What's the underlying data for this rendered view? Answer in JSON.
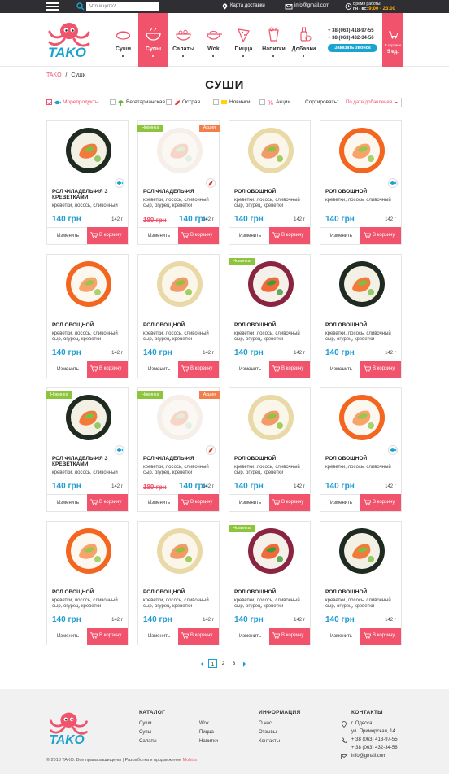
{
  "topbar": {
    "search_placeholder": "Что ищете?",
    "delivery_map": "Карта доставки",
    "email": "info@gmail.com",
    "hours_label": "Время работы:",
    "hours_days": "пн - вс:",
    "hours_time": "9:00 - 23:00"
  },
  "nav": [
    {
      "label": "Суши",
      "icon": "sushi-icon",
      "active": false
    },
    {
      "label": "Супы",
      "icon": "soup-icon",
      "active": true
    },
    {
      "label": "Салаты",
      "icon": "salad-icon",
      "active": false
    },
    {
      "label": "Wok",
      "icon": "wok-icon",
      "active": false
    },
    {
      "label": "Пицца",
      "icon": "pizza-icon",
      "active": false
    },
    {
      "label": "Напитки",
      "icon": "drink-icon",
      "active": false
    },
    {
      "label": "Добавки",
      "icon": "sauce-icon",
      "active": false
    }
  ],
  "contacts": {
    "phone1": "+ 38 (063) 418-97-55",
    "phone2": "+ 38 (063) 432-34-56",
    "call_button": "Заказать звонок"
  },
  "cart": {
    "label": "В корзине",
    "count": "5 ед."
  },
  "breadcrumbs": {
    "home": "TAKO",
    "sep": "/",
    "current": "Суши"
  },
  "page_title": "СУШИ",
  "filters": [
    {
      "label": "Морепродукты",
      "checked": true,
      "color": "#f0536b"
    },
    {
      "label": "Вегетарианская",
      "checked": false,
      "color": "#333333"
    },
    {
      "label": "Острая",
      "checked": false,
      "color": "#333333"
    },
    {
      "label": "Новинки",
      "checked": false,
      "color": "#333333"
    },
    {
      "label": "Акции",
      "checked": false,
      "color": "#333333"
    }
  ],
  "sort": {
    "label": "Сортировать:",
    "value": "По дате добавления"
  },
  "card_buttons": {
    "edit": "Изменить",
    "buy": "В корзину"
  },
  "badges": {
    "new": "Новинка",
    "sale": "Акция"
  },
  "products": [
    {
      "title": "РОЛ ФІЛАДЕЛЬФІЯ З КРЕВЕТКАМИ",
      "desc": "креветки, лосось, сливочный",
      "price": "140 грн",
      "weight": "142 г",
      "img": "green",
      "icon": "fish-icon"
    },
    {
      "title": "РОЛ ФІЛАДЕЛЬФІЯ",
      "desc": "креветки, лосось, сливочный сыр, огурец, креветки",
      "old_price": "189 грн",
      "price": "140 грн",
      "weight": "142 г",
      "img": "pale",
      "new": true,
      "sale": true,
      "icon": "pepper-icon"
    },
    {
      "title": "РОЛ ОВОЩНОЙ",
      "desc": "креветки, лосось, сливочный сыр, огурец, креветки",
      "price": "140 грн",
      "weight": "142 г",
      "img": "sesame"
    },
    {
      "title": "РОЛ ОВОЩНОЙ",
      "desc": "креветки, лосось, сливочный",
      "price": "140 грн",
      "weight": "142 г",
      "img": "orange",
      "icon": "fish-icon"
    },
    {
      "title": "РОЛ ОВОЩНОЙ",
      "desc": "креветки, лосось, сливочный сыр, огурец, креветки",
      "price": "140 грн",
      "weight": "142 г",
      "img": "orange"
    },
    {
      "title": "РОЛ ОВОЩНОЙ",
      "desc": "креветки, лосось, сливочный сыр, огурец, креветки",
      "price": "140 грн",
      "weight": "142 г",
      "img": "sesame"
    },
    {
      "title": "РОЛ ОВОЩНОЙ",
      "desc": "креветки, лосось, сливочный сыр, огурец, креветки",
      "price": "140 грн",
      "weight": "142 г",
      "img": "purple",
      "new": true
    },
    {
      "title": "РОЛ ОВОЩНОЙ",
      "desc": "креветки, лосось, сливочный сыр, огурец, креветки",
      "price": "140 грн",
      "weight": "142 г",
      "img": "green"
    },
    {
      "title": "РОЛ ФІЛАДЕЛЬФІЯ З КРЕВЕТКАМИ",
      "desc": "креветки, лосось, сливочный",
      "price": "140 грн",
      "weight": "142 г",
      "img": "green",
      "new": true,
      "icon": "fish-icon"
    },
    {
      "title": "РОЛ ФІЛАДЕЛЬФІЯ",
      "desc": "креветки, лосось, сливочный сыр, огурец, креветки",
      "old_price": "189 грн",
      "price": "140 грн",
      "weight": "142 г",
      "img": "pale",
      "new": true,
      "sale": true,
      "icon": "pepper-icon"
    },
    {
      "title": "РОЛ ОВОЩНОЙ",
      "desc": "креветки, лосось, сливочный сыр, огурец, креветки",
      "price": "140 грн",
      "weight": "142 г",
      "img": "sesame"
    },
    {
      "title": "РОЛ ОВОЩНОЙ",
      "desc": "креветки, лосось, сливочный",
      "price": "140 грн",
      "weight": "142 г",
      "img": "orange",
      "icon": "fish-icon"
    },
    {
      "title": "РОЛ ОВОЩНОЙ",
      "desc": "креветки, лосось, сливочный сыр, огурец, креветки",
      "price": "140 грн",
      "weight": "142 г",
      "img": "orange"
    },
    {
      "title": "РОЛ ОВОЩНОЙ",
      "desc": "креветки, лосось, сливочный сыр, огурец, креветки",
      "price": "140 грн",
      "weight": "142 г",
      "img": "sesame"
    },
    {
      "title": "РОЛ ОВОЩНОЙ",
      "desc": "креветки, лосось, сливочный сыр, огурец, креветки",
      "price": "140 грн",
      "weight": "142 г",
      "img": "purple",
      "new": true
    },
    {
      "title": "РОЛ ОВОЩНОЙ",
      "desc": "креветки, лосось, сливочный сыр, огурец, креветки",
      "price": "140 грн",
      "weight": "142 г",
      "img": "green"
    }
  ],
  "pagination": {
    "pages": [
      "1",
      "2",
      "3"
    ],
    "current": "1"
  },
  "footer": {
    "catalog_title": "КАТАЛОГ",
    "catalog_col1": [
      "Суши",
      "Супы",
      "Салаты"
    ],
    "catalog_col2": [
      "Wok",
      "Пицца",
      "Напитки"
    ],
    "info_title": "ИНФОРМАЦИЯ",
    "info_links": [
      "О нас",
      "Отзывы",
      "Контакты"
    ],
    "contacts_title": "КОНТАКТЫ",
    "address1": "г. Одесса,",
    "address2": "ул. Приморская, 14",
    "phone1": "+ 38 (063) 418-97-55",
    "phone2": "+ 38 (063) 432-34-56",
    "email": "info@gmail.com",
    "copyright": "© 2018 TAKO. Все права защищены | Разработка и продвижение",
    "developer": "Mobiss"
  },
  "colors": {
    "accent": "#f0536b",
    "blue": "#1e9dd2",
    "green": "#8cc43b",
    "orange": "#f27e4a",
    "dark": "#2f2f33"
  }
}
